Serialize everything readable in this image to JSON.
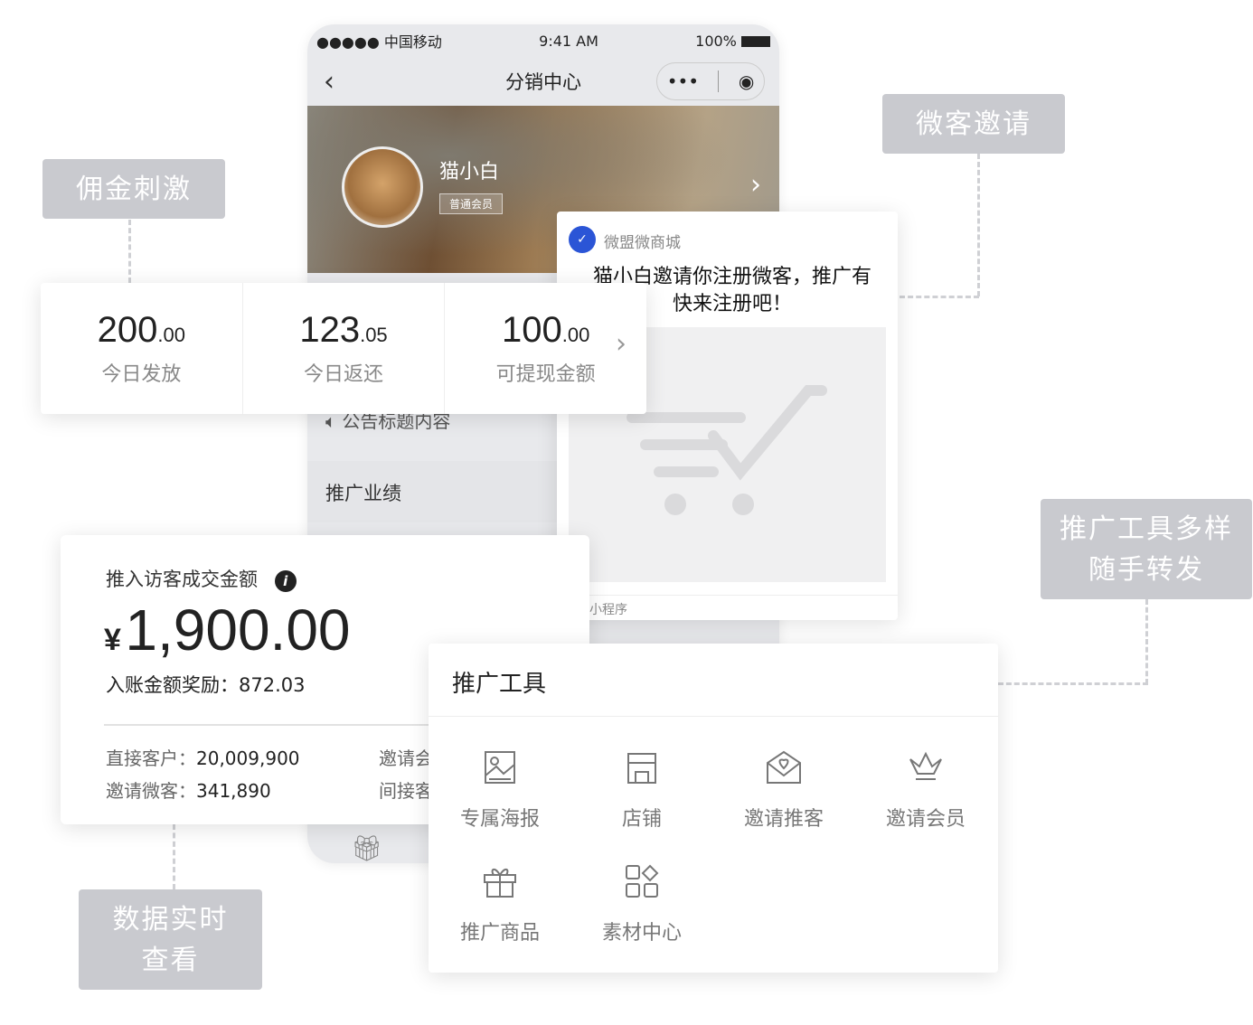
{
  "tags": {
    "commission": "佣金刺激",
    "invite": "微客邀请",
    "tools": [
      "推广工具多样",
      "随手转发"
    ],
    "realtime": [
      "数据实时",
      "查看"
    ]
  },
  "phone": {
    "carrier": "●●●●● 中国移动",
    "time": "9:41 AM",
    "battery": "100%",
    "title": "分销中心",
    "user_name": "猫小白",
    "member_badge": "普通会员",
    "announcement": "公告标题内容",
    "section": "推广业绩"
  },
  "stats": [
    {
      "int": "200",
      "dec": ".00",
      "label": "今日发放"
    },
    {
      "int": "123",
      "dec": ".05",
      "label": "今日返还"
    },
    {
      "int": "100",
      "dec": ".00",
      "label": "可提现金额"
    }
  ],
  "share": {
    "app_name": "微盟微商城",
    "message_line1": "猫小白邀请你注册微客，推广有",
    "message_line2": "快来注册吧！",
    "footer": "小程序",
    "brand_color": "#2b55d6"
  },
  "sales": {
    "title": "推入访客成交金额",
    "currency": "¥",
    "amount": "1,900.00",
    "reward_label": "入账金额奖励：",
    "reward": "872.03",
    "rows": [
      {
        "label": "直接客户：",
        "value": "20,009,900"
      },
      {
        "label": "邀请微客：",
        "value": "341,890"
      }
    ],
    "right_labels": [
      "邀请会",
      "间接客"
    ]
  },
  "tools": {
    "title": "推广工具",
    "items": [
      {
        "label": "专属海报",
        "icon": "poster-icon"
      },
      {
        "label": "店铺",
        "icon": "store-icon"
      },
      {
        "label": "邀请推客",
        "icon": "invite-mail-icon"
      },
      {
        "label": "邀请会员",
        "icon": "crown-icon"
      },
      {
        "label": "推广商品",
        "icon": "gift-icon"
      },
      {
        "label": "素材中心",
        "icon": "grid-icon"
      }
    ]
  }
}
